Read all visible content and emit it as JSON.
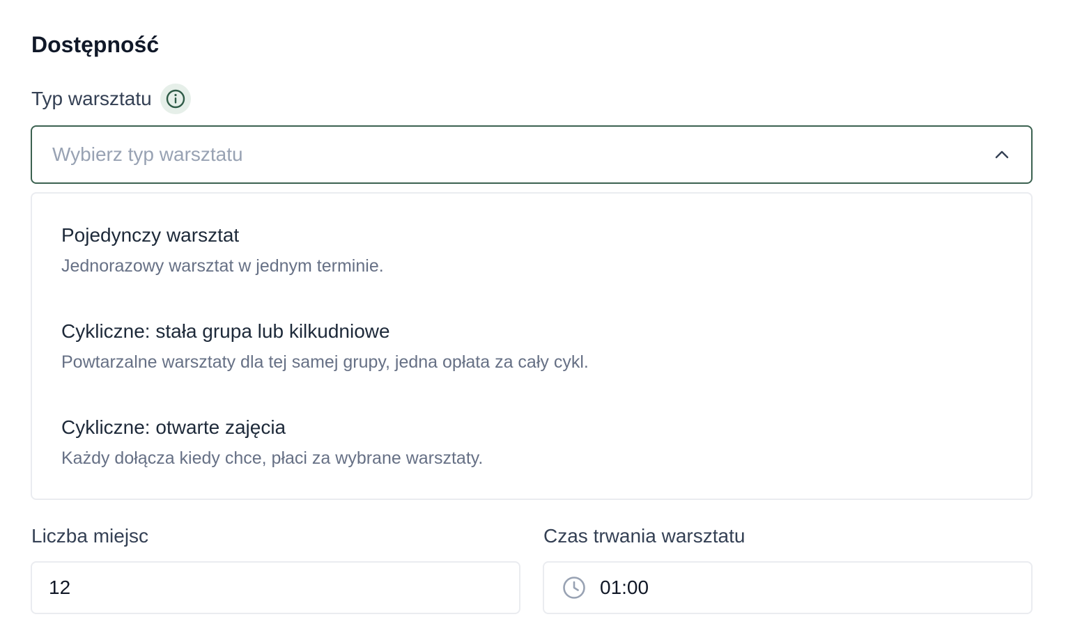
{
  "section": {
    "title": "Dostępność"
  },
  "workshop_type": {
    "label": "Typ warsztatu",
    "info_icon": "info-icon",
    "placeholder": "Wybierz typ warsztatu",
    "chevron_icon": "chevron-up-icon",
    "options": [
      {
        "title": "Pojedynczy warsztat",
        "description": "Jednorazowy warsztat w jednym terminie."
      },
      {
        "title": "Cykliczne: stała grupa lub kilkudniowe",
        "description": "Powtarzalne warsztaty dla tej samej grupy, jedna opłata za cały cykl."
      },
      {
        "title": "Cykliczne: otwarte zajęcia",
        "description": "Każdy dołącza kiedy chce, płaci za wybrane warsztaty."
      }
    ]
  },
  "seats": {
    "label": "Liczba miejsc",
    "value": "12"
  },
  "duration": {
    "label": "Czas trwania warsztatu",
    "clock_icon": "clock-icon",
    "value": "01:00"
  },
  "colors": {
    "accent_border": "#3b6150",
    "info_badge_bg": "#e6efe9",
    "info_icon": "#2f5b47",
    "placeholder": "#98a2b3",
    "muted_text": "#667085",
    "border": "#eaecf0"
  }
}
